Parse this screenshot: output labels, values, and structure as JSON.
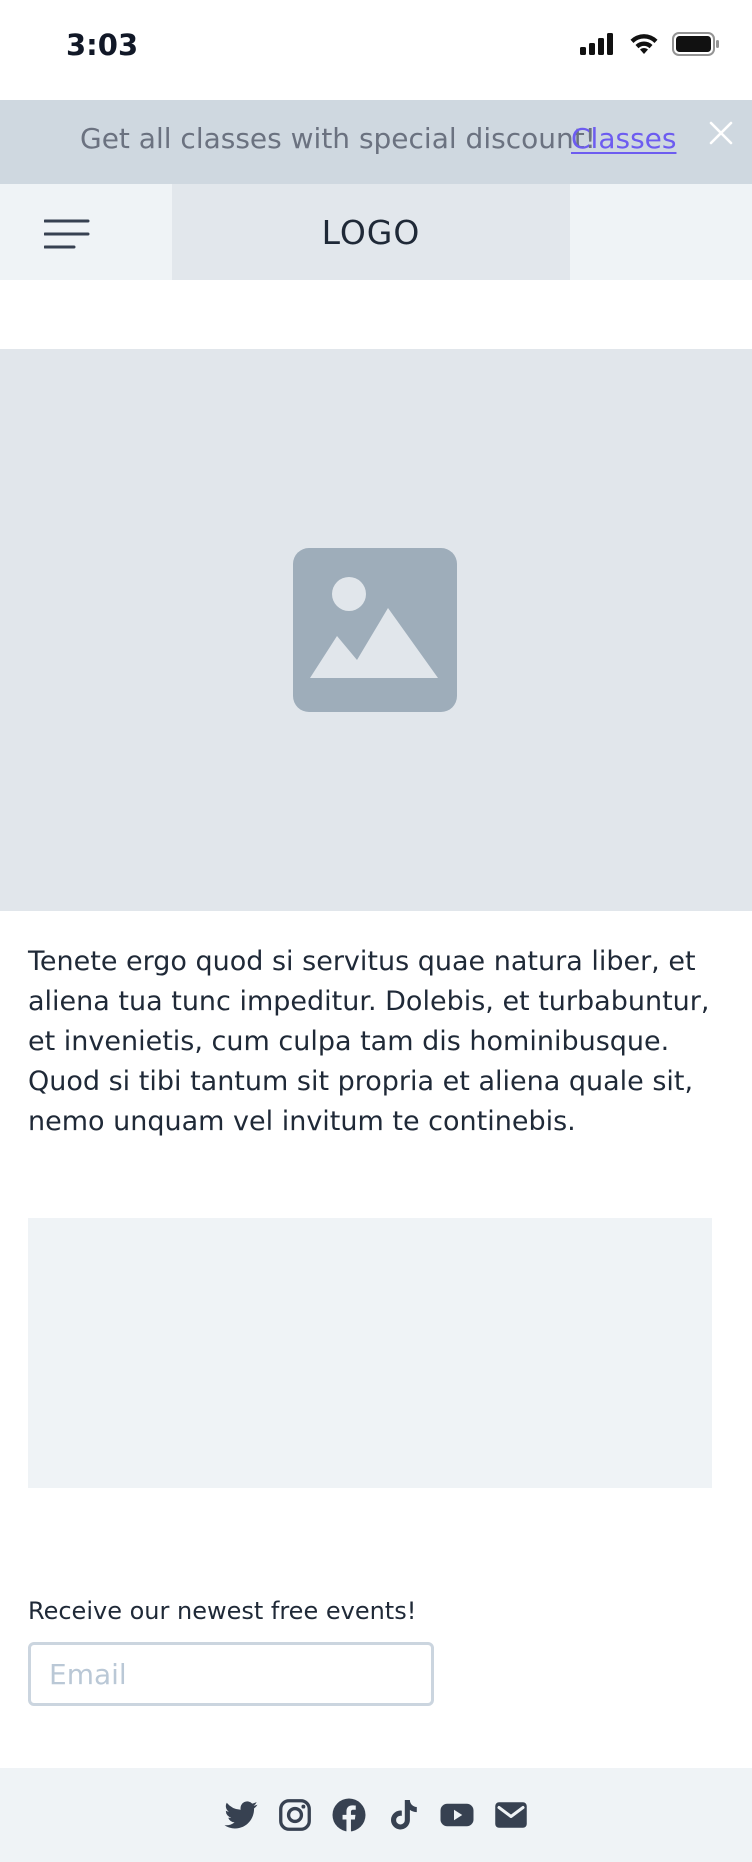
{
  "status_bar": {
    "time": "3:03"
  },
  "promo_banner": {
    "text": "Get all classes with special discount!",
    "link_label": "Classes"
  },
  "navbar": {
    "logo": "LOGO"
  },
  "hero": {
    "image_icon": "image-placeholder-icon"
  },
  "content": {
    "paragraph": "Tenete ergo quod si servitus quae natura liber, et aliena tua tunc impeditur. Dolebis, et turbabuntur, et invenietis, cum culpa tam dis hominibusque. Quod si tibi tantum sit propria et aliena quale sit, nemo unquam vel invitum te continebis."
  },
  "newsletter": {
    "label": "Receive our newest free events!",
    "email_placeholder": "Email",
    "email_value": ""
  },
  "footer": {
    "social_icons": [
      "twitter-icon",
      "instagram-icon",
      "facebook-icon",
      "tiktok-icon",
      "youtube-icon",
      "email-icon"
    ]
  },
  "colors": {
    "accent_link": "#6d5cf0",
    "banner_bg": "#cfd8e0",
    "nav_bg": "#eff3f6",
    "logo_bg": "#e2e7ec",
    "hero_bg": "#e1e6eb",
    "icon_gray": "#9eadba"
  }
}
